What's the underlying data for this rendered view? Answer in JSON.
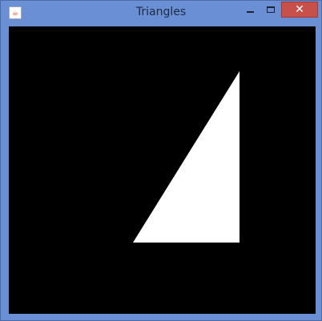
{
  "window": {
    "title": "Triangles",
    "close_glyph": "✕",
    "app_icon": "java-icon"
  },
  "canvas": {
    "background": "#000000",
    "shape": {
      "type": "triangle",
      "fill": "#ffffff"
    }
  }
}
